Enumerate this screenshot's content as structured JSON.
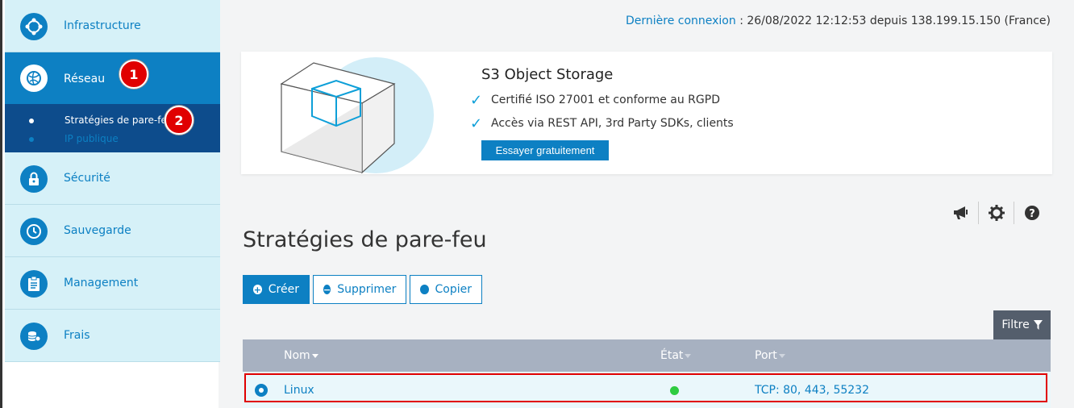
{
  "sidebar": {
    "items": [
      {
        "label": "Infrastructure",
        "icon": "infrastructure-icon"
      },
      {
        "label": "Réseau",
        "icon": "globe-icon"
      },
      {
        "label": "Sécurité",
        "icon": "lock-icon"
      },
      {
        "label": "Sauvegarde",
        "icon": "clock-icon"
      },
      {
        "label": "Management",
        "icon": "clipboard-icon"
      },
      {
        "label": "Frais",
        "icon": "coins-icon"
      }
    ],
    "submenu": [
      {
        "label": "Stratégies de pare-feu"
      },
      {
        "label": "IP publique"
      }
    ]
  },
  "badges": [
    "1",
    "2"
  ],
  "header": {
    "last_login_label": "Dernière connexion",
    "last_login_value": " : 26/08/2022 12:12:53 depuis 138.199.15.150 (France)"
  },
  "promo": {
    "title": "S3 Object Storage",
    "features": [
      "Certifié ISO 27001 et conforme au RGPD",
      "Accès via REST API, 3rd Party SDKs, clients"
    ],
    "cta": "Essayer gratuitement"
  },
  "page": {
    "title": "Stratégies de pare-feu"
  },
  "toolbar": {
    "create": "Créer",
    "delete": "Supprimer",
    "copy": "Copier",
    "filter": "Filtre"
  },
  "table": {
    "columns": [
      "Nom",
      "État",
      "Port"
    ],
    "rows": [
      {
        "name": "Linux",
        "state": "active",
        "port": "TCP: 80, 443, 55232"
      }
    ]
  },
  "colors": {
    "accent": "#0d80c3",
    "sidebar_bg": "#d6f1f8",
    "submenu_bg": "#0d4c8c",
    "table_header": "#a7b1c1",
    "status_ok": "#2ecc40",
    "annotation": "#e00000"
  }
}
